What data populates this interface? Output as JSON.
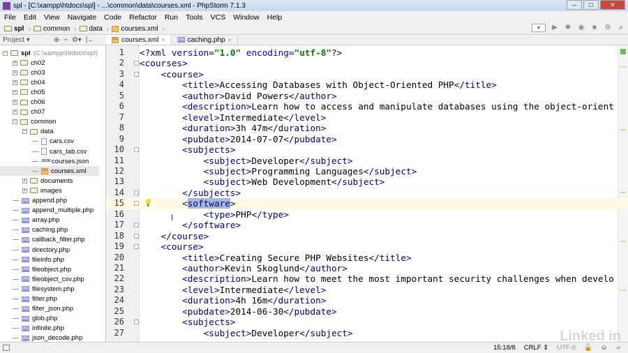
{
  "window": {
    "title": "spl - [C:\\xampp\\htdocs\\spl] - ...\\common\\data\\courses.xml - PhpStorm 7.1.3"
  },
  "menu": [
    "File",
    "Edit",
    "View",
    "Navigate",
    "Code",
    "Refactor",
    "Run",
    "Tools",
    "VCS",
    "Window",
    "Help"
  ],
  "breadcrumb": [
    "spl",
    "common",
    "data",
    "courses.xml"
  ],
  "project_panel": {
    "label": "Project"
  },
  "tabs": [
    {
      "label": "courses.xml",
      "icon": "xml-file-icon",
      "active": true
    },
    {
      "label": "caching.php",
      "icon": "php-file-icon",
      "active": false
    }
  ],
  "tree": [
    {
      "label": "spl",
      "extra": "(C:\\xampp\\htdocs\\spl)",
      "level": 0,
      "type": "folder",
      "expanded": true
    },
    {
      "label": "ch02",
      "level": 1,
      "type": "folder",
      "expanded": false
    },
    {
      "label": "ch03",
      "level": 1,
      "type": "folder",
      "expanded": false
    },
    {
      "label": "ch04",
      "level": 1,
      "type": "folder",
      "expanded": false
    },
    {
      "label": "ch05",
      "level": 1,
      "type": "folder",
      "expanded": false
    },
    {
      "label": "ch06",
      "level": 1,
      "type": "folder",
      "expanded": false
    },
    {
      "label": "ch07",
      "level": 1,
      "type": "folder",
      "expanded": false
    },
    {
      "label": "common",
      "level": 1,
      "type": "folder",
      "expanded": true
    },
    {
      "label": "data",
      "level": 2,
      "type": "folder",
      "expanded": true
    },
    {
      "label": "cars.csv",
      "level": 3,
      "type": "text"
    },
    {
      "label": "cars_tab.csv",
      "level": 3,
      "type": "text"
    },
    {
      "label": "courses.json",
      "level": 3,
      "type": "json"
    },
    {
      "label": "courses.xml",
      "level": 3,
      "type": "xml",
      "selected": true
    },
    {
      "label": "documents",
      "level": 2,
      "type": "folder",
      "expanded": false
    },
    {
      "label": "images",
      "level": 2,
      "type": "folder",
      "expanded": false
    },
    {
      "label": "append.php",
      "level": 1,
      "type": "php"
    },
    {
      "label": "append_multiple.php",
      "level": 1,
      "type": "php"
    },
    {
      "label": "array.php",
      "level": 1,
      "type": "php"
    },
    {
      "label": "caching.php",
      "level": 1,
      "type": "php"
    },
    {
      "label": "callback_filter.php",
      "level": 1,
      "type": "php"
    },
    {
      "label": "directory.php",
      "level": 1,
      "type": "php"
    },
    {
      "label": "fileinfo.php",
      "level": 1,
      "type": "php"
    },
    {
      "label": "fileobject.php",
      "level": 1,
      "type": "php"
    },
    {
      "label": "fileobject_csv.php",
      "level": 1,
      "type": "php"
    },
    {
      "label": "filesystem.php",
      "level": 1,
      "type": "php"
    },
    {
      "label": "filter.php",
      "level": 1,
      "type": "php"
    },
    {
      "label": "filter_json.php",
      "level": 1,
      "type": "php"
    },
    {
      "label": "glob.php",
      "level": 1,
      "type": "php"
    },
    {
      "label": "infinite.php",
      "level": 1,
      "type": "php"
    },
    {
      "label": "json_decode.php",
      "level": 1,
      "type": "php"
    }
  ],
  "editor": {
    "current_line": 15,
    "selected_text": "software",
    "lines": [
      "<?xml version=\"1.0\" encoding=\"utf-8\"?>",
      "<courses>",
      "    <course>",
      "        <title>Accessing Databases with Object-Oriented PHP</title>",
      "        <author>David Powers</author>",
      "        <description>Learn how to access and manipulate databases using the object-orient",
      "        <level>Intermediate</level>",
      "        <duration>3h 47m</duration>",
      "        <pubdate>2014-07-07</pubdate>",
      "        <subjects>",
      "            <subject>Developer</subject>",
      "            <subject>Programming Languages</subject>",
      "            <subject>Web Development</subject>",
      "        </subjects>",
      "        <software>",
      "            <type>PHP</type>",
      "        </software>",
      "    </course>",
      "    <course>",
      "        <title>Creating Secure PHP Websites</title>",
      "        <author>Kevin Skoglund</author>",
      "        <description>Learn how to meet the most important security challenges when develo",
      "        <level>Intermediate</level>",
      "        <duration>4h 16m</duration>",
      "        <pubdate>2014-06-30</pubdate>",
      "        <subjects>",
      "            <subject>Developer</subject>"
    ],
    "fold_lines": [
      2,
      3,
      10,
      14,
      15,
      17,
      18,
      19,
      26
    ]
  },
  "status": {
    "position": "15:18/8",
    "line_separator": "CRLF",
    "encoding": "UTF-8"
  },
  "watermark": "Linkedin"
}
